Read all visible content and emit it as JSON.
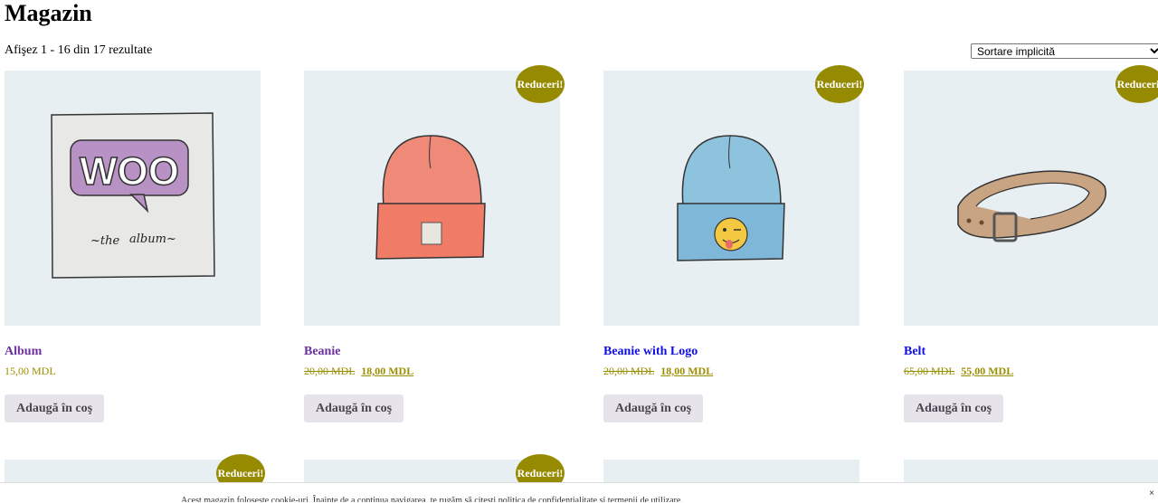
{
  "page": {
    "title": "Magazin",
    "result_count": "Afişez 1 - 16 din 17 rezultate"
  },
  "sort": {
    "selected": "Sortare implicită"
  },
  "badge_label": "Reduceri!",
  "add_to_cart_label": "Adaugă în coş",
  "products": [
    {
      "name": "Album",
      "price": "15,00 MDL",
      "sale": false
    },
    {
      "name": "Beanie",
      "old_price": "20,00 MDL",
      "price": "18,00 MDL",
      "sale": true
    },
    {
      "name": "Beanie with Logo",
      "old_price": "20,00 MDL",
      "price": "18,00 MDL",
      "sale": true
    },
    {
      "name": "Belt",
      "old_price": "65,00 MDL",
      "price": "55,00 MDL",
      "sale": true
    }
  ],
  "colors": {
    "badge": "#968b00",
    "thumb_bg": "#e8eff3",
    "visited_link": "#6a2fa0",
    "link": "#1010e6",
    "price": "#9a8f00"
  },
  "footer": {
    "text": "Acest magazin foloseşte cookie-uri. Înainte de a continua navigarea, te rugăm să citeşti politica de confidenţialitate şi termenii de utilizare.",
    "close": "×"
  }
}
